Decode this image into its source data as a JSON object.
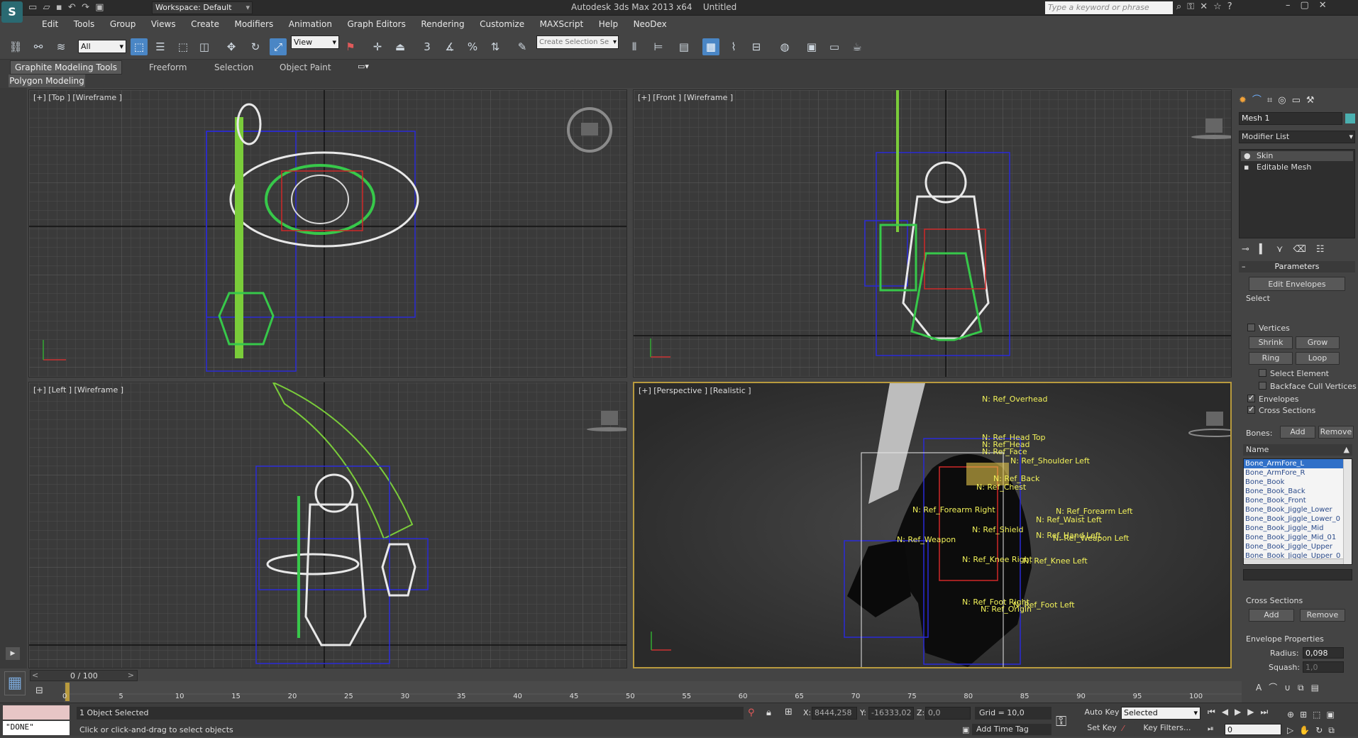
{
  "title": {
    "app": "Autodesk 3ds Max 2013 x64",
    "doc": "Untitled",
    "workspace": "Workspace: Default",
    "search_placeholder": "Type a keyword or phrase"
  },
  "menu": [
    "Edit",
    "Tools",
    "Group",
    "Views",
    "Create",
    "Modifiers",
    "Animation",
    "Graph Editors",
    "Rendering",
    "Customize",
    "MAXScript",
    "Help",
    "NeoDex"
  ],
  "toolbar": {
    "filter": "All",
    "refcoord": "View",
    "selset": "Create Selection Se"
  },
  "ribbon": {
    "tabs": [
      "Graphite Modeling Tools",
      "Freeform",
      "Selection",
      "Object Paint"
    ],
    "sub": "Polygon Modeling"
  },
  "viewports": {
    "top": "[+] [Top ] [Wireframe ]",
    "front": "[+] [Front ] [Wireframe ]",
    "left": "[+] [Left ] [Wireframe ]",
    "persp": "[+] [Perspective ] [Realistic ]"
  },
  "bone_tags": [
    "N: Ref_Overhead",
    "N: Ref_Head Top",
    "N: Ref_Head",
    "N: Ref_Face",
    "N: Ref_Shoulder Left",
    "N: Ref_Back",
    "N: Ref_Chest",
    "N: Ref_Forearm Right",
    "N: Ref_Forearm Left",
    "N: Ref_Waist Left",
    "N: Ref_Shield",
    "N: Ref_Hand Left",
    "N: Ref_Weapon Left",
    "N: Ref_Weapon",
    "N: Ref_Knee Right",
    "N: Ref_Knee Left",
    "N: Ref_Foot Right",
    "N: Ref_Foot Left",
    "N: Ref_Origin"
  ],
  "panel": {
    "object_name": "Mesh 1",
    "modifier_list": "Modifier List",
    "stack": [
      "Skin",
      "Editable Mesh"
    ],
    "rollout": "Parameters",
    "edit_env": "Edit Envelopes",
    "select": "Select",
    "vertices": "Vertices",
    "shrink": "Shrink",
    "grow": "Grow",
    "ring": "Ring",
    "loop": "Loop",
    "sel_element": "Select Element",
    "backface": "Backface Cull Vertices",
    "envelopes": "Envelopes",
    "cross_sections": "Cross Sections",
    "bones_label": "Bones:",
    "add": "Add",
    "remove": "Remove",
    "name_col": "Name",
    "bones": [
      "Bone_ArmFore_L",
      "Bone_ArmFore_R",
      "Bone_Book",
      "Bone_Book_Back",
      "Bone_Book_Front",
      "Bone_Book_Jiggle_Lower",
      "Bone_Book_Jiggle_Lower_0",
      "Bone_Book_Jiggle_Mid",
      "Bone_Book_Jiggle_Mid_01",
      "Bone_Book_Jiggle_Upper",
      "Bone_Book_Jiggle_Upper_0"
    ],
    "cs_group": "Cross Sections",
    "cs_add": "Add",
    "cs_remove": "Remove",
    "env_props": "Envelope Properties",
    "radius_label": "Radius:",
    "radius": "0,098",
    "squash_label": "Squash:",
    "squash": "1,0"
  },
  "timeline": {
    "frame": "0 / 100",
    "ticks": [
      "0",
      "5",
      "10",
      "15",
      "20",
      "25",
      "30",
      "35",
      "40",
      "45",
      "50",
      "55",
      "60",
      "65",
      "70",
      "75",
      "80",
      "85",
      "90",
      "95",
      "100"
    ]
  },
  "status": {
    "listener": "\"DONE\"",
    "selected": "1 Object Selected",
    "prompt": "Click or click-and-drag to select objects",
    "x_label": "X:",
    "x": "8444,258",
    "y_label": "Y:",
    "y": "-16333,02",
    "z_label": "Z:",
    "z": "0,0",
    "grid": "Grid = 10,0",
    "add_time_tag": "Add Time Tag",
    "autokey": "Auto Key",
    "setkey": "Set Key",
    "keymode": "Selected",
    "keyfilters": "Key Filters...",
    "frame_field": "0"
  }
}
